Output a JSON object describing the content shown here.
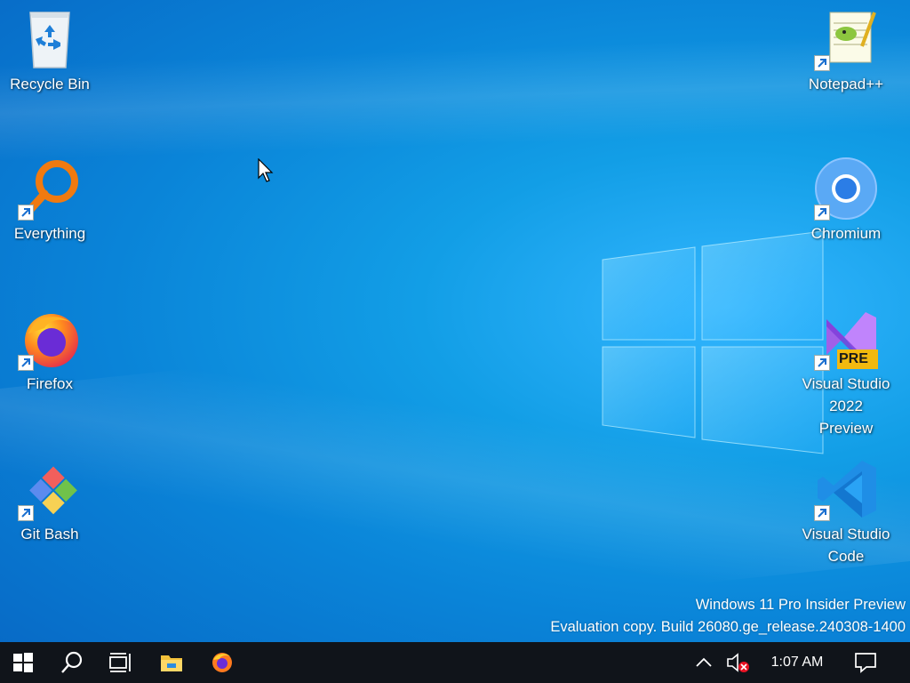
{
  "desktop": {
    "icons_left": [
      {
        "label": "Recycle Bin",
        "icon": "recycle-bin-icon"
      },
      {
        "label": "Everything",
        "icon": "everything-icon"
      },
      {
        "label": "Firefox",
        "icon": "firefox-icon"
      },
      {
        "label": "Git Bash",
        "icon": "git-bash-icon"
      }
    ],
    "icons_right": [
      {
        "label": "Notepad++",
        "icon": "notepad-plus-plus-icon"
      },
      {
        "label": "Chromium",
        "icon": "chromium-icon"
      },
      {
        "label_line1": "Visual Studio",
        "label_line2": "2022 Preview",
        "badge": "PRE",
        "icon": "visual-studio-preview-icon"
      },
      {
        "label_line1": "Visual Studio",
        "label_line2": "Code",
        "icon": "vscode-icon"
      }
    ]
  },
  "watermark": {
    "line1": "Windows 11 Pro Insider Preview",
    "line2": "Evaluation copy. Build 26080.ge_release.240308-1400"
  },
  "taskbar": {
    "items": [
      "start-icon",
      "search-icon",
      "task-view-icon",
      "file-explorer-icon",
      "firefox-taskbar-icon"
    ],
    "tray": {
      "chevron": "chevron-up-icon",
      "volume": "volume-muted-icon",
      "time": "1:07 AM",
      "notifications": "action-center-icon"
    }
  },
  "colors": {
    "desktop_bg": "#0f8fe0",
    "taskbar_bg": "#10141a"
  }
}
